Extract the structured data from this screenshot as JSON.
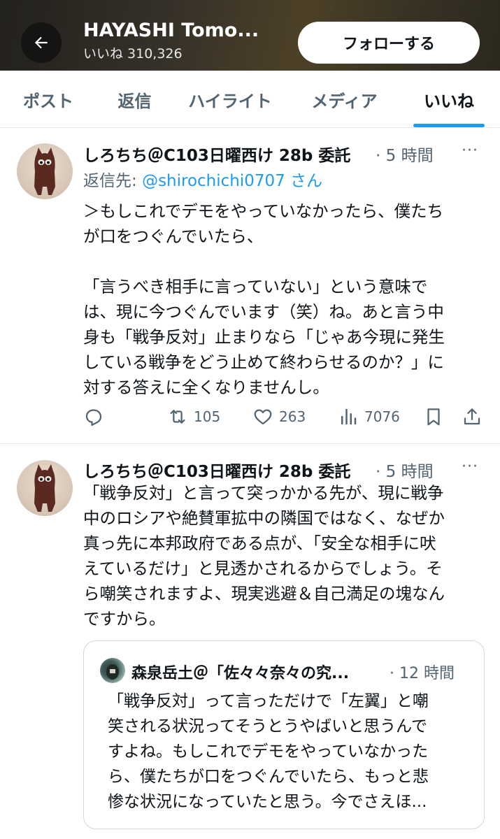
{
  "header": {
    "title": "HAYASHI Tomo...",
    "subtitle": "いいね 310,326",
    "follow_label": "フォローする"
  },
  "tabs": [
    {
      "label": "ポスト",
      "active": false
    },
    {
      "label": "返信",
      "active": false
    },
    {
      "label": "ハイライト",
      "active": false
    },
    {
      "label": "メディア",
      "active": false
    },
    {
      "label": "いいね",
      "active": true
    }
  ],
  "posts": [
    {
      "author": "しろちち＠C103日曜西け 28b 委託",
      "time": "· 5 時間",
      "more": "···",
      "reply_prefix": "返信先: ",
      "reply_handle": "@shirochichi0707 さん",
      "text": "＞もしこれでデモをやっていなかったら、僕たち\nが口をつぐんでいたら、\n\n「言うべき相手に言っていない」という意味で\nは、現に今つぐんでいます（笑）ね。あと言う中\n身も「戦争反対」止まりなら「じゃあ今現に発生\nしている戦争をどう止めて終わらせるのか？」に\n対する答えに全くなりませんし。",
      "actions": {
        "reply": "",
        "repost": "105",
        "like": "263",
        "views": "7076"
      }
    },
    {
      "author": "しろちち＠C103日曜西け 28b 委託",
      "time": "· 5 時間",
      "more": "···",
      "text": "「戦争反対」と言って突っかかる先が、現に戦争\n中のロシアや絶賛軍拡中の隣国ではなく、なぜか\n真っ先に本邦政府である点が、「安全な相手に吠\nえているだけ」と見透かされるからでしょう。そ\nら嘲笑されますよ、現実逃避＆自己満足の塊なん\nですから。",
      "quote": {
        "author": "森泉岳土＠「佐々々奈々の究...",
        "time": "· 12 時間",
        "text": "「戦争反対」って言っただけで「左翼」と嘲\n笑される状況ってそうとうやばいと思うんで\nすよね。もしこれでデモをやっていなかった\nら、僕たちが口をつぐんでいたら、もっと悲\n惨な状況になっていたと思う。今でさえほ..."
      }
    }
  ],
  "colors": {
    "accent": "#1d9bf0",
    "secondary_text": "#536471",
    "primary_text": "#0f1419"
  }
}
